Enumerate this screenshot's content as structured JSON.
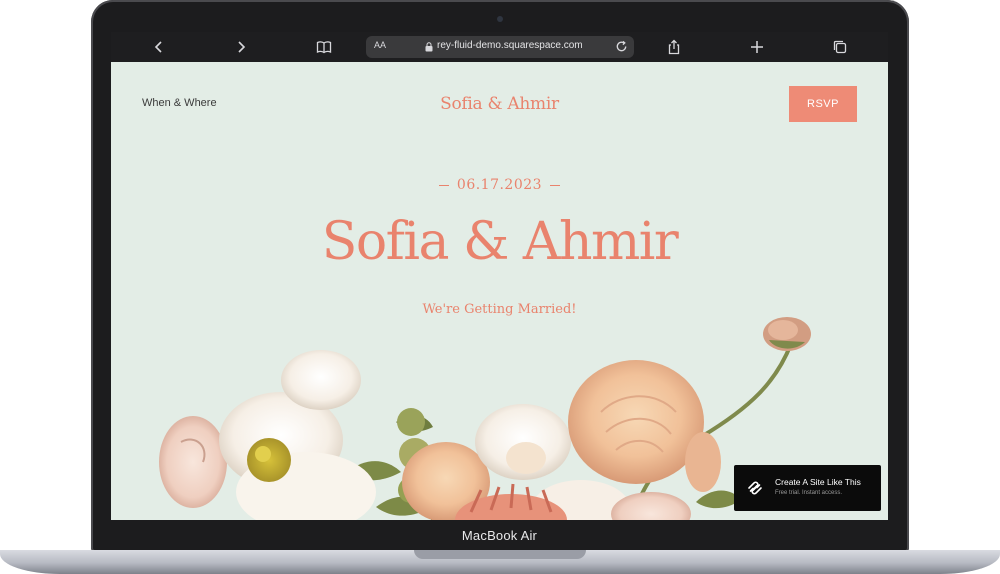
{
  "device": {
    "label": "MacBook Air"
  },
  "browser": {
    "text_size_label": "AA",
    "url": "rey-fluid-demo.squarespace.com",
    "icons": [
      "chevron-left-icon",
      "chevron-right-icon",
      "book-icon",
      "lock-icon",
      "reload-icon",
      "share-icon",
      "plus-icon",
      "tabs-icon"
    ]
  },
  "site": {
    "nav_link": "When & Where",
    "brand": "Sofia & Ahmir",
    "rsvp_label": "RSVP",
    "date": "06.17.2023",
    "hero_title": "Sofia & Ahmir",
    "subtitle": "We're Getting Married!"
  },
  "promo": {
    "title": "Create A Site Like This",
    "subtitle": "Free trial. Instant access.",
    "icon": "squarespace-logo-icon"
  },
  "colors": {
    "page_background": "#e3ede6",
    "accent": "#e9836d",
    "button": "#ee8b76",
    "toolbar": "#1e1e20"
  }
}
